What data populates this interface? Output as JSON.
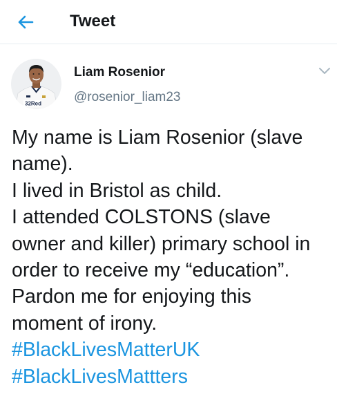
{
  "header": {
    "back_icon": "arrow-left-icon",
    "title": "Tweet"
  },
  "author": {
    "avatar_icon": "profile-photo",
    "avatar_shirt_text": "32Red",
    "name": "Liam Rosenior",
    "handle": "@rosenior_liam23",
    "menu_icon": "chevron-down-icon"
  },
  "tweet": {
    "lines": [
      "My name is Liam Rosenior (slave",
      "name).",
      "I lived in Bristol as child.",
      "I attended COLSTONS (slave",
      "owner and killer) primary school in",
      "order to receive my “education”.",
      "Pardon me for enjoying this",
      "moment of irony."
    ],
    "hashtags": [
      "#BlackLivesMatterUK",
      "#BlackLivesMattters"
    ]
  },
  "colors": {
    "accent": "#1b95e0",
    "text": "#14171a",
    "secondary": "#657786",
    "divider": "#e6ecf0"
  }
}
